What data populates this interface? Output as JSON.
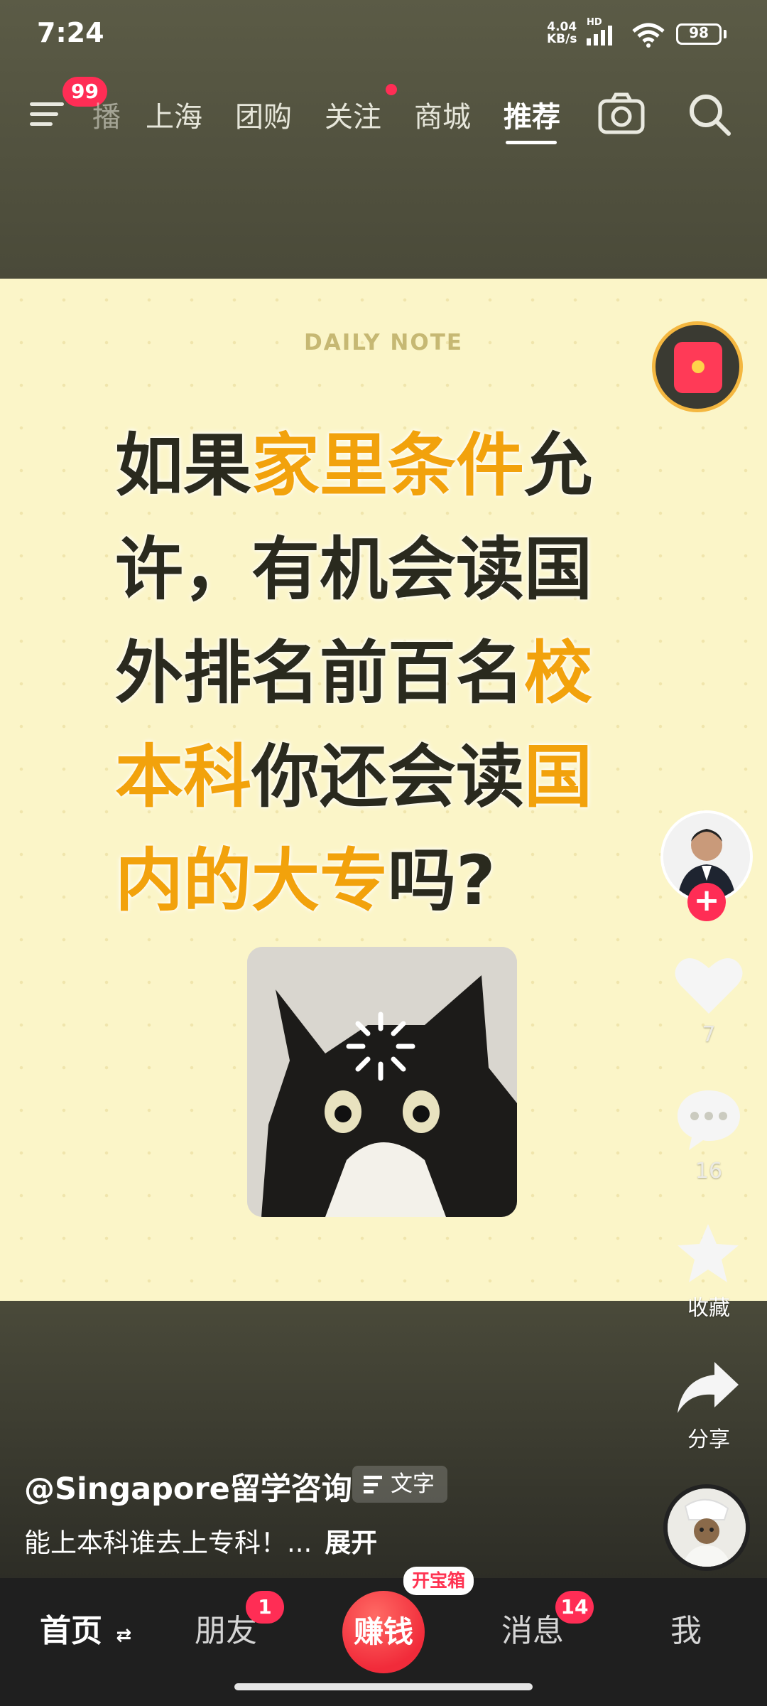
{
  "status_bar": {
    "time": "7:24",
    "net_speed_value": "4.04",
    "net_speed_unit": "KB/s",
    "network_tag": "HD",
    "battery": "98"
  },
  "top_nav": {
    "menu_badge": "99",
    "partial_tab": "播",
    "tabs": [
      "上海",
      "团购",
      "关注",
      "商城",
      "推荐"
    ],
    "active_tab": "推荐"
  },
  "video": {
    "header": "DAILY NOTE",
    "headline_segments": [
      {
        "text": "如果",
        "highlight": false
      },
      {
        "text": "家里条件",
        "highlight": true
      },
      {
        "text": "允许，有机会读国外排名前百名",
        "highlight": false
      },
      {
        "text": "校本科",
        "highlight": true
      },
      {
        "text": "你还会读",
        "highlight": false
      },
      {
        "text": "国内的大专",
        "highlight": true
      },
      {
        "text": "吗?",
        "highlight": false
      }
    ],
    "highlight_color": "#f2a20c",
    "background_color": "#fbf5c8"
  },
  "right_rail": {
    "like_count": "7",
    "comment_count": "16",
    "favorite_label": "收藏",
    "share_label": "分享"
  },
  "post": {
    "author": "@Singapore留学咨询",
    "text_chip": "文字",
    "caption": "能上本科谁去上专科！...",
    "expand": "展开"
  },
  "bottom_nav": {
    "home": "首页",
    "friends": "朋友",
    "friends_badge": "1",
    "earn": "赚钱",
    "earn_tag": "开宝箱",
    "messages": "消息",
    "messages_badge": "14",
    "me": "我"
  }
}
